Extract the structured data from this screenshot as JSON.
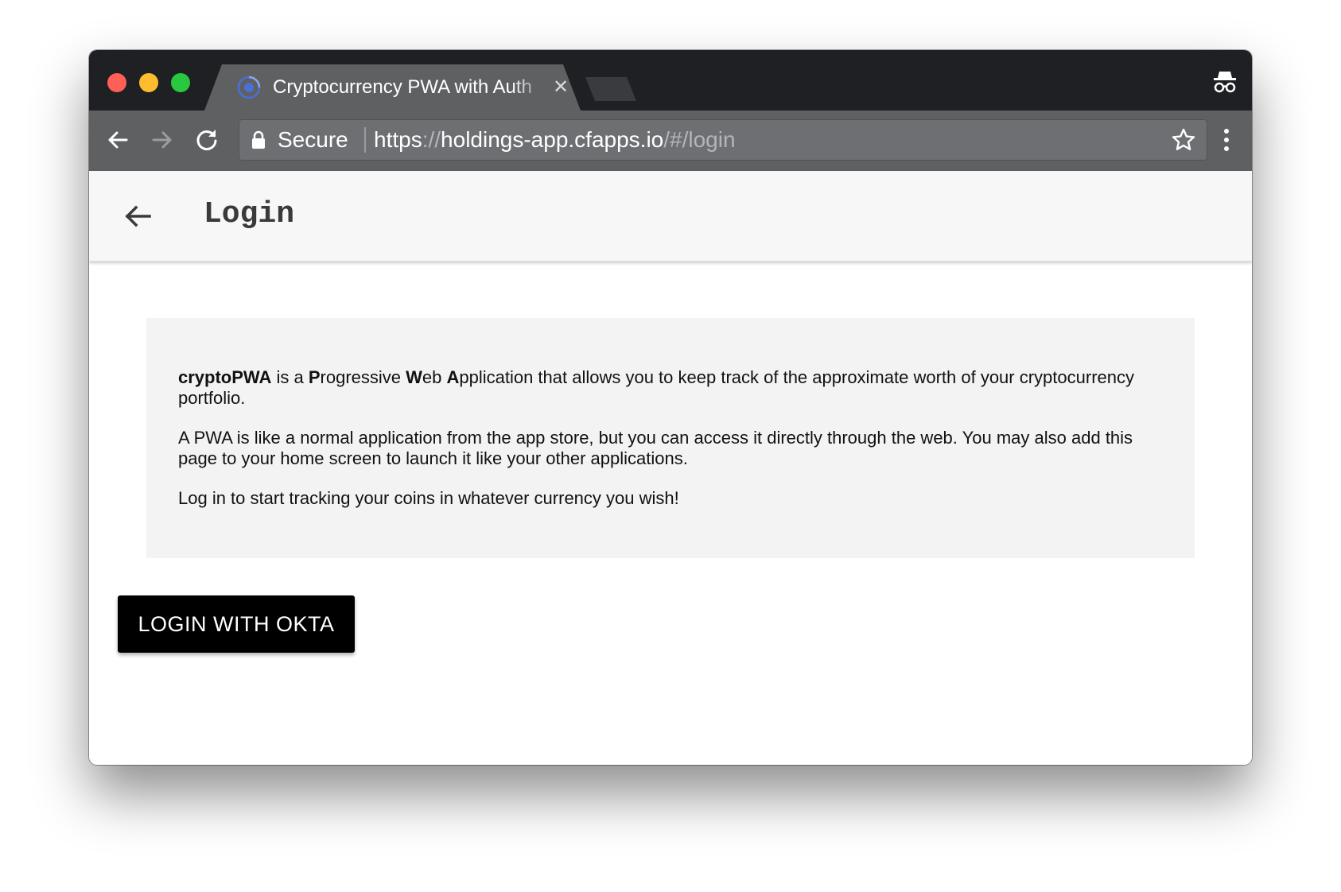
{
  "browser": {
    "tab": {
      "title": "Cryptocurrency PWA with Auth",
      "close_glyph": "✕",
      "favicon": "angular-favicon-icon"
    },
    "address_bar": {
      "secure_label": "Secure",
      "url_scheme": "https",
      "url_sep": "://",
      "url_host": "holdings-app.cfapps.io",
      "url_path": "/#/login"
    },
    "icons": {
      "back": "arrow-back-icon",
      "forward": "arrow-forward-icon",
      "reload": "reload-icon",
      "lock": "lock-icon",
      "star": "star-icon",
      "menu": "more-vert-icon",
      "incognito": "incognito-icon"
    },
    "colors": {
      "titlebar": "#1f2023",
      "toolbar": "#5f6062",
      "traffic_red": "#fe5f57",
      "traffic_yellow": "#febc2e",
      "traffic_green": "#28c840"
    }
  },
  "app": {
    "header": {
      "title": "Login",
      "back_icon": "arrow-back-icon"
    },
    "intro": {
      "app_name": "cryptoPWA",
      "p1_a": " is a ",
      "p1_P": "P",
      "p1_b": "rogressive ",
      "p1_W": "W",
      "p1_c": "eb ",
      "p1_A": "A",
      "p1_d": "pplication that allows you to keep track of the approximate worth of your cryptocurrency portfolio.",
      "p2": "A PWA is like a normal application from the app store, but you can access it directly through the web. You may also add this page to your home screen to launch it like your other applications.",
      "p3": "Log in to start tracking your coins in whatever currency you wish!"
    },
    "login_button": {
      "label": "LOGIN WITH OKTA"
    },
    "colors": {
      "header_bg": "#f7f7f7",
      "card_bg": "#f3f3f3",
      "button_bg": "#000000",
      "button_text": "#ffffff"
    }
  }
}
